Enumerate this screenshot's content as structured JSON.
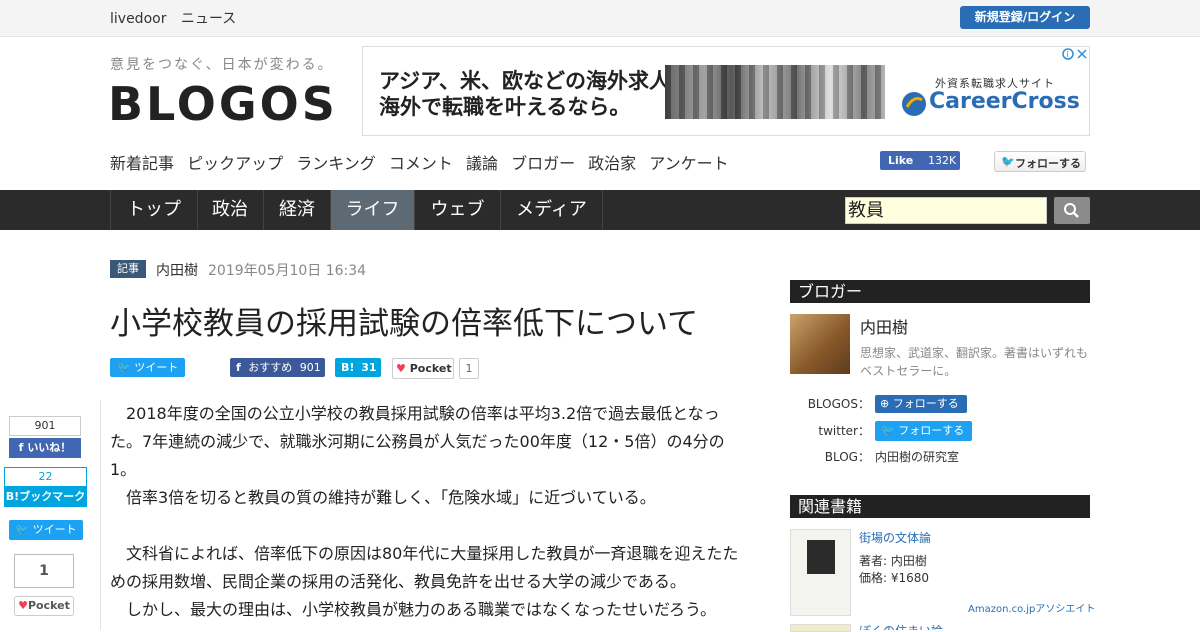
{
  "topbar": {
    "brand": "livedoor",
    "news": "ニュース",
    "register_login": "新規登録/ログイン"
  },
  "header": {
    "tagline": "意見をつなぐ、日本が変わる。",
    "logo": "BLOGOS"
  },
  "ad": {
    "line1": "アジア、米、欧などの海外求人。",
    "line2": "海外で転職を叶えるなら。",
    "caption": "外資系転職求人サイト",
    "brand": "CareerCross"
  },
  "main_nav": [
    "新着記事",
    "ピックアップ",
    "ランキング",
    "コメント",
    "議論",
    "ブロガー",
    "政治家",
    "アンケート"
  ],
  "social_header": {
    "fb_like": "Like",
    "fb_count": "132K",
    "twitter_follow": "フォローする"
  },
  "categories": [
    "トップ",
    "政治",
    "経済",
    "ライフ",
    "ウェブ",
    "メディア"
  ],
  "active_category": "ライフ",
  "search": {
    "value": "教員"
  },
  "article": {
    "badge": "記事",
    "author": "内田樹",
    "date": "2019年05月10日 16:34",
    "title": "小学校教員の採用試験の倍率低下について",
    "share": {
      "tweet": "ツイート",
      "fb_recommend": "おすすめ",
      "fb_count": "901",
      "hatena_count": "31",
      "pocket": "Pocket",
      "pocket_count": "1"
    },
    "paragraphs": [
      "　2018年度の全国の公立小学校の教員採用試験の倍率は平均3.2倍で過去最低となった。7年連続の減少で、就職氷河期に公務員が人気だった00年度（12・5倍）の4分の1。",
      "　倍率3倍を切ると教員の質の維持が難しく、「危険水域」に近づいている。",
      "",
      "　文科省によれば、倍率低下の原因は80年代に大量採用した教員が一斉退職を迎えたための採用数増、民間企業の採用の活発化、教員免許を出せる大学の減少である。",
      "　しかし、最大の理由は、小学校教員が魅力のある職業ではなくなったせいだろう。"
    ]
  },
  "float_share": {
    "fb_count": "901",
    "fb_label": "いいね！",
    "hatena_count": "22",
    "hatena_label": "ブックマーク",
    "tweet": "ツイート",
    "pocket_count": "1",
    "pocket_label": "Pocket"
  },
  "sidebar": {
    "blogger_heading": "ブロガー",
    "blogger_name": "内田樹",
    "blogger_desc": "思想家、武道家、翻訳家。著書はいずれもベストセラーに。",
    "blogos_label": "BLOGOS：",
    "blogos_follow": "フォローする",
    "twitter_label": "twitter：",
    "twitter_follow": "フォローする",
    "blog_label": "BLOG：",
    "blog_link": "内田樹の研究室",
    "books_heading": "関連書籍",
    "book1": {
      "title": "街場の文体論",
      "author": "著者: 内田樹",
      "price": "価格: ¥1680"
    },
    "amazon": "Amazon.co.jpアソシエイト",
    "book2": {
      "title": "ぼくの住まい論"
    }
  },
  "colors": {
    "nav_bg": "#2b2b2b",
    "active_tab": "#5e6a73",
    "accent_blue": "#2a6db5",
    "twitter": "#1da1f2",
    "facebook": "#4267b2",
    "hatena": "#00a4de"
  }
}
